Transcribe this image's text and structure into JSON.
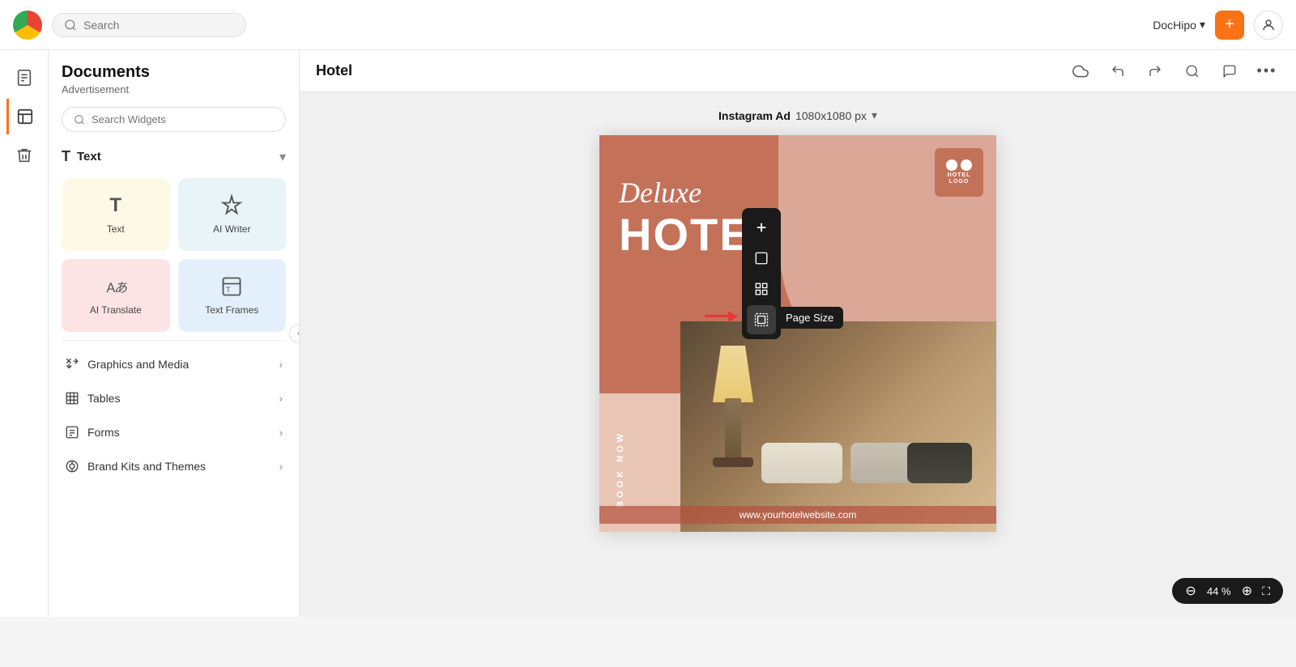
{
  "topbar": {
    "search_placeholder": "Search",
    "brand_name": "DocHipo",
    "add_button_label": "+",
    "chevron": "▾"
  },
  "sidebar_icons": [
    {
      "name": "document-icon",
      "symbol": "🗋",
      "active": false
    },
    {
      "name": "template-icon",
      "symbol": "📄",
      "active": true
    },
    {
      "name": "trash-icon",
      "symbol": "🗑",
      "active": false
    }
  ],
  "left_panel": {
    "title": "Documents",
    "subtitle": "Advertisement",
    "search_placeholder": "Search Widgets",
    "text_section": {
      "label": "Text",
      "chevron": "▾"
    },
    "widgets": [
      {
        "id": "text",
        "label": "Text",
        "color": "yellow"
      },
      {
        "id": "ai-writer",
        "label": "AI Writer",
        "color": "blue"
      },
      {
        "id": "ai-translate",
        "label": "AI Translate",
        "color": "pink"
      },
      {
        "id": "text-frames",
        "label": "Text Frames",
        "color": "light-blue"
      }
    ],
    "menu_items": [
      {
        "id": "graphics-media",
        "label": "Graphics and Media",
        "icon": "✂",
        "chevron": ">"
      },
      {
        "id": "tables",
        "label": "Tables",
        "icon": "⊞",
        "chevron": ">"
      },
      {
        "id": "forms",
        "label": "Forms",
        "icon": "⊟",
        "chevron": ">"
      },
      {
        "id": "brand-kits",
        "label": "Brand Kits and Themes",
        "icon": "⊡",
        "chevron": ">"
      }
    ]
  },
  "canvas": {
    "title": "Hotel",
    "page_size_label": "Instagram Ad",
    "page_size_value": "1080x1080 px",
    "chevron": "▾",
    "toolbar_icons": [
      "cloud",
      "undo",
      "redo",
      "search",
      "comment",
      "more"
    ],
    "design": {
      "heading1": "Deluxe",
      "heading2": "HOTEL",
      "cta": "BOOK NOW",
      "logo_line1": "HOTEL",
      "logo_line2": "LOGO",
      "website": "www.yourhotelwebsite.com"
    },
    "floating_toolbar": {
      "buttons": [
        "plus",
        "frame",
        "grid",
        "page-size"
      ],
      "tooltip": "Page Size"
    }
  },
  "zoom_bar": {
    "minus": "⊖",
    "value": "44 %",
    "plus": "⊕",
    "fullscreen": "⛶"
  },
  "colors": {
    "orange_accent": "#f97316",
    "canvas_primary": "#c4715a",
    "canvas_secondary": "#dba898",
    "canvas_bg": "#e8c5b5"
  }
}
